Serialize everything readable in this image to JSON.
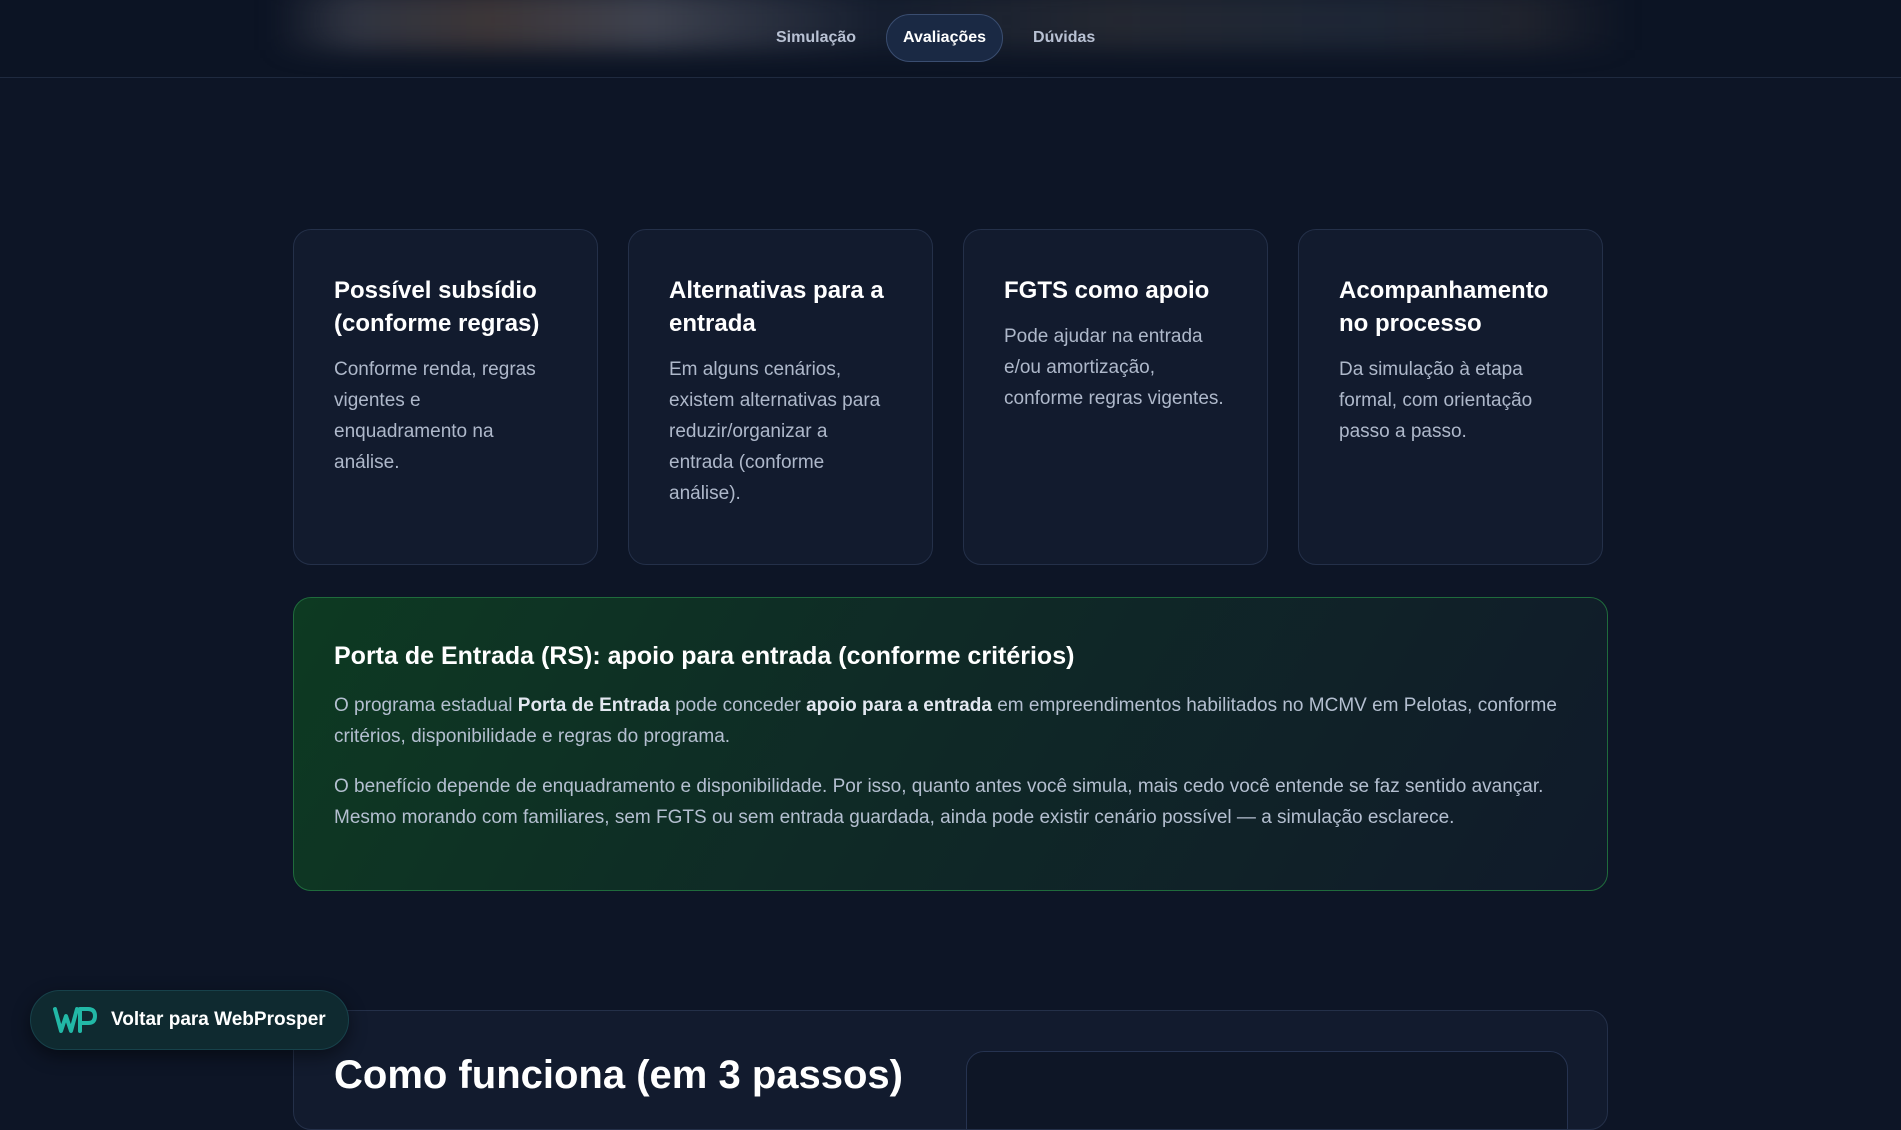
{
  "nav": {
    "tabs": [
      {
        "label": "Simulação"
      },
      {
        "label": "Avaliações"
      },
      {
        "label": "Dúvidas"
      }
    ],
    "active": "Avaliações"
  },
  "cards": [
    {
      "title": "Possível subsídio (conforme regras)",
      "text": "Conforme renda, regras vigentes e enquadramento na análise."
    },
    {
      "title": "Alternativas para a entrada",
      "text": "Em alguns cenários, existem alternativas para reduzir/organizar a entrada (conforme análise)."
    },
    {
      "title": "FGTS como apoio",
      "text": "Pode ajudar na entrada e/ou amortização, conforme regras vigentes."
    },
    {
      "title": "Acompanhamento no processo",
      "text": "Da simulação à etapa formal, com orientação passo a passo."
    }
  ],
  "highlight": {
    "title": "Porta de Entrada (RS): apoio para entrada (conforme critérios)",
    "p1_a": "O programa estadual ",
    "p1_b": "Porta de Entrada",
    "p1_c": " pode conceder ",
    "p1_d": "apoio para a entrada",
    "p1_e": " em empreendimentos habilitados no MCMV em Pelotas, conforme critérios, disponibilidade e regras do programa.",
    "p2": "O benefício depende de enquadramento e disponibilidade. Por isso, quanto antes você simula, mais cedo você entende se faz sentido avançar. Mesmo morando com familiares, sem FGTS ou sem entrada guardada, ainda pode existir cenário possível — a simulação esclarece."
  },
  "how_it_works": {
    "title": "Como funciona (em 3 passos)"
  },
  "back_button": {
    "logo": "WP",
    "label": "Voltar para WebProsper"
  },
  "colors": {
    "background": "#0d1526",
    "card": "#121b2e",
    "accent_green": "#1f6b3c",
    "logo_teal": "#22b8a6"
  }
}
